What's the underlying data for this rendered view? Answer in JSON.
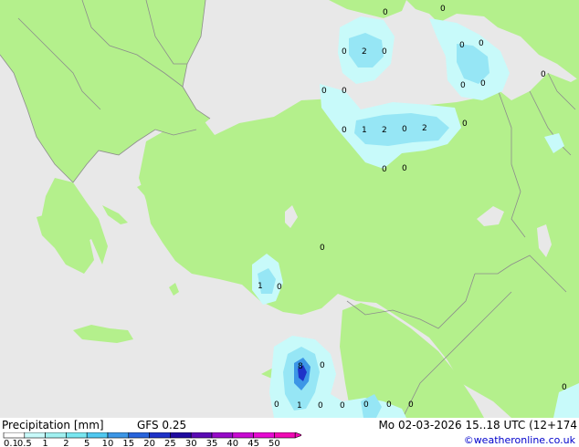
{
  "header": {
    "title": "Precipitation [mm]",
    "model": "GFS 0.25",
    "datetime": "Mo 02-03-2026 15..18 UTC (12+174",
    "credit": "©weatheronline.co.uk"
  },
  "legend": {
    "labels": [
      "0.1",
      "0.5",
      "1",
      "2",
      "5",
      "10",
      "15",
      "20",
      "25",
      "30",
      "35",
      "40",
      "45",
      "50"
    ],
    "colors": [
      "#ffffff",
      "#c8fafa",
      "#a0f0f0",
      "#78e6f0",
      "#50c8f0",
      "#3c96e6",
      "#2864dc",
      "#1e32c8",
      "#1e0aa0",
      "#5a0ab4",
      "#960ac8",
      "#c80ad2",
      "#e60ad2",
      "#f00ab4"
    ]
  },
  "map": {
    "colors": {
      "sea": "#e8e8e8",
      "land": "#b4f08c",
      "border": "#8c8c8c",
      "light_precip": "#c8fafa",
      "moderate_precip": "#96e6f5"
    },
    "rain_values": [
      {
        "v": "0"
      },
      {
        "v": "0"
      },
      {
        "v": "2"
      },
      {
        "v": "0"
      },
      {
        "v": "0"
      },
      {
        "v": "0"
      },
      {
        "v": "0"
      },
      {
        "v": "0"
      },
      {
        "v": "0"
      },
      {
        "v": "0"
      },
      {
        "v": "0"
      },
      {
        "v": "0"
      },
      {
        "v": "1"
      },
      {
        "v": "2"
      },
      {
        "v": "0"
      },
      {
        "v": "2"
      },
      {
        "v": "0"
      },
      {
        "v": "0"
      },
      {
        "v": "0"
      },
      {
        "v": "0"
      },
      {
        "v": "0"
      },
      {
        "v": "1"
      },
      {
        "v": "0"
      },
      {
        "v": "8"
      },
      {
        "v": "0"
      },
      {
        "v": "0"
      },
      {
        "v": "1"
      },
      {
        "v": "0"
      },
      {
        "v": "0"
      },
      {
        "v": "0"
      },
      {
        "v": "0"
      },
      {
        "v": "0"
      },
      {
        "v": "0"
      }
    ]
  }
}
